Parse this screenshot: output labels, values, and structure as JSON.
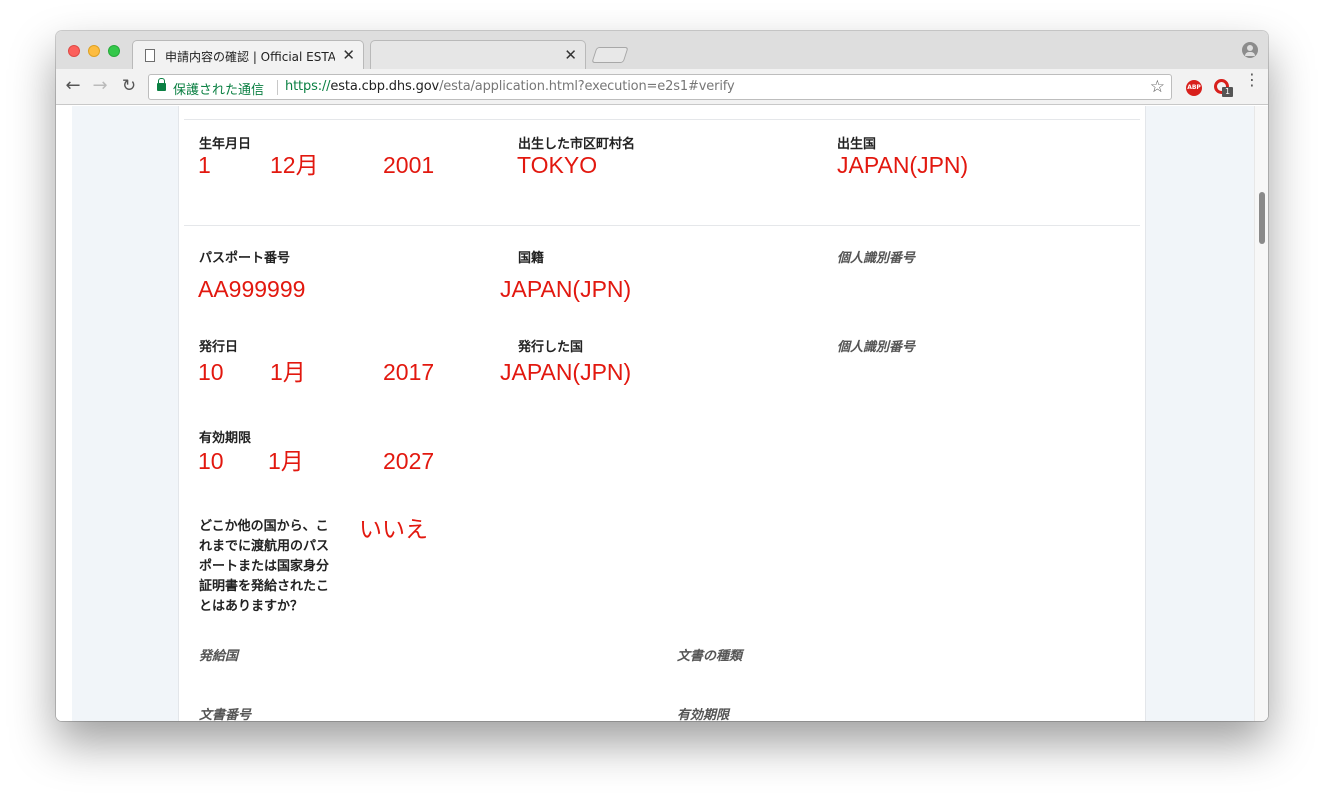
{
  "browser": {
    "tab_active_title": "申請内容の確認 | Official ESTA Application Website, U.S. Customs and Border Protection",
    "tab_close": "✕",
    "tab_inactive_close": "✕",
    "secure_label": "保護された通信",
    "url_scheme": "https://",
    "url_host": "esta.cbp.dhs.gov",
    "url_path": "/esta/application.html?execution=e2s1#verify",
    "back_icon": "←",
    "forward_icon": "→",
    "reload_icon": "↻",
    "star_icon": "☆",
    "abp_label": "ABP",
    "ext_badge": "1",
    "menu_icon": "⋮"
  },
  "birth": {
    "dob_label": "生年月日",
    "dob_day": "1",
    "dob_month": "12月",
    "dob_year": "2001",
    "city_label": "出生した市区町村名",
    "city_value": "TOKYO",
    "country_label": "出生国",
    "country_value": "JAPAN(JPN)"
  },
  "passport": {
    "number_label": "パスポート番号",
    "number_value": "AA999999",
    "nationality_label": "国籍",
    "nationality_value": "JAPAN(JPN)",
    "personal_id_label_1": "個人識別番号",
    "issue_date_label": "発行日",
    "issue_day": "10",
    "issue_month": "1月",
    "issue_year": "2017",
    "issue_country_label": "発行した国",
    "issue_country_value": "JAPAN(JPN)",
    "personal_id_label_2": "個人識別番号",
    "expiry_label": "有効期限",
    "expiry_day": "10",
    "expiry_month": "1月",
    "expiry_year": "2027"
  },
  "other_passport": {
    "question": "どこか他の国から、これまでに渡航用のパスポートまたは国家身分証明書を発給されたことはありますか？",
    "answer": "いいえ",
    "issuing_country_label": "発給国",
    "document_type_label": "文書の種類",
    "document_number_label": "文書番号",
    "expiry_label": "有効期限"
  }
}
